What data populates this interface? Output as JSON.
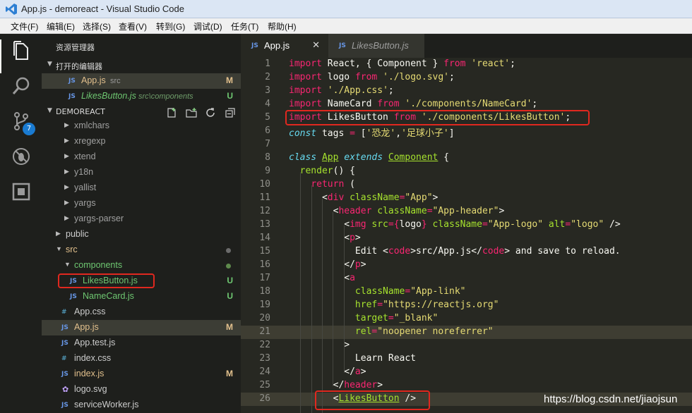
{
  "window": {
    "title": "App.js - demoreact - Visual Studio Code"
  },
  "menu": [
    "文件(F)",
    "编辑(E)",
    "选择(S)",
    "查看(V)",
    "转到(G)",
    "调试(D)",
    "任务(T)",
    "帮助(H)"
  ],
  "activity": {
    "scm_badge": "7"
  },
  "sidebar": {
    "title": "资源管理器",
    "open_editors_header": "打开的编辑器",
    "open_editors": [
      {
        "name": "App.js",
        "path": "src",
        "decoration": "M"
      },
      {
        "name": "LikesButton.js",
        "path": "src\\components",
        "decoration": "U"
      }
    ],
    "project_header": "DEMOREACT",
    "tree": [
      {
        "name": "xmlchars"
      },
      {
        "name": "xregexp"
      },
      {
        "name": "xtend"
      },
      {
        "name": "y18n"
      },
      {
        "name": "yallist"
      },
      {
        "name": "yargs"
      },
      {
        "name": "yargs-parser"
      },
      {
        "name": "public"
      },
      {
        "name": "src"
      },
      {
        "name": "components"
      },
      {
        "name": "LikesButton.js",
        "decoration": "U"
      },
      {
        "name": "NameCard.js",
        "decoration": "U"
      },
      {
        "name": "App.css"
      },
      {
        "name": "App.js",
        "decoration": "M"
      },
      {
        "name": "App.test.js"
      },
      {
        "name": "index.css"
      },
      {
        "name": "index.js",
        "decoration": "M"
      },
      {
        "name": "logo.svg"
      },
      {
        "name": "serviceWorker.js"
      }
    ]
  },
  "tabs": [
    {
      "name": "App.js",
      "icon_text": "JS",
      "close": "✕"
    },
    {
      "name": "LikesButton.js",
      "icon_text": "JS"
    }
  ],
  "file_icon_text": "JS",
  "code": {
    "line_numbers": [
      "1",
      "2",
      "3",
      "4",
      "5",
      "6",
      "7",
      "8",
      "9",
      "10",
      "11",
      "12",
      "13",
      "14",
      "15",
      "16",
      "17",
      "18",
      "19",
      "20",
      "21",
      "22",
      "23",
      "24",
      "25",
      "26"
    ],
    "lines": [
      [
        [
          "k",
          "import"
        ],
        [
          "p",
          " React, { Component } "
        ],
        [
          "k",
          "from"
        ],
        [
          "p",
          " "
        ],
        [
          "s",
          "'react'"
        ],
        [
          "p",
          ";"
        ]
      ],
      [
        [
          "k",
          "import"
        ],
        [
          "p",
          " logo "
        ],
        [
          "k",
          "from"
        ],
        [
          "p",
          " "
        ],
        [
          "s",
          "'./logo.svg'"
        ],
        [
          "p",
          ";"
        ]
      ],
      [
        [
          "k",
          "import"
        ],
        [
          "p",
          " "
        ],
        [
          "s",
          "'./App.css'"
        ],
        [
          "p",
          ";"
        ]
      ],
      [
        [
          "k",
          "import"
        ],
        [
          "p",
          " NameCard "
        ],
        [
          "k",
          "from"
        ],
        [
          "p",
          " "
        ],
        [
          "s",
          "'./components/NameCard'"
        ],
        [
          "p",
          ";"
        ]
      ],
      [
        [
          "k",
          "import"
        ],
        [
          "p",
          " LikesButton "
        ],
        [
          "k",
          "from"
        ],
        [
          "p",
          " "
        ],
        [
          "s",
          "'./components/LikesButton'"
        ],
        [
          "p",
          ";"
        ]
      ],
      [
        [
          "b",
          "const"
        ],
        [
          "p",
          " tags "
        ],
        [
          "k",
          "="
        ],
        [
          "p",
          " ["
        ],
        [
          "s",
          "'恐龙'"
        ],
        [
          "p",
          ","
        ],
        [
          "s",
          "'足球小子'"
        ],
        [
          "p",
          "]"
        ]
      ],
      [],
      [
        [
          "b",
          "class"
        ],
        [
          "p",
          " "
        ],
        [
          "c",
          "App"
        ],
        [
          "p",
          " "
        ],
        [
          "b",
          "extends"
        ],
        [
          "p",
          " "
        ],
        [
          "c",
          "Component"
        ],
        [
          "p",
          " {"
        ]
      ],
      [
        [
          "p",
          "  "
        ],
        [
          "a",
          "render"
        ],
        [
          "p",
          "() {"
        ]
      ],
      [
        [
          "p",
          "    "
        ],
        [
          "k",
          "return"
        ],
        [
          "p",
          " ("
        ]
      ],
      [
        [
          "p",
          "      <"
        ],
        [
          "k",
          "div"
        ],
        [
          "p",
          " "
        ],
        [
          "a",
          "className"
        ],
        [
          "k",
          "="
        ],
        [
          "s",
          "\"App\""
        ],
        [
          "p",
          ">"
        ]
      ],
      [
        [
          "p",
          "        <"
        ],
        [
          "k",
          "header"
        ],
        [
          "p",
          " "
        ],
        [
          "a",
          "className"
        ],
        [
          "k",
          "="
        ],
        [
          "s",
          "\"App-header\""
        ],
        [
          "p",
          ">"
        ]
      ],
      [
        [
          "p",
          "          <"
        ],
        [
          "k",
          "img"
        ],
        [
          "p",
          " "
        ],
        [
          "a",
          "src"
        ],
        [
          "k",
          "="
        ],
        [
          "k",
          "{"
        ],
        [
          "p",
          "logo"
        ],
        [
          "k",
          "}"
        ],
        [
          "p",
          " "
        ],
        [
          "a",
          "className"
        ],
        [
          "k",
          "="
        ],
        [
          "s",
          "\"App-logo\""
        ],
        [
          "p",
          " "
        ],
        [
          "a",
          "alt"
        ],
        [
          "k",
          "="
        ],
        [
          "s",
          "\"logo\""
        ],
        [
          "p",
          " />"
        ]
      ],
      [
        [
          "p",
          "          <"
        ],
        [
          "k",
          "p"
        ],
        [
          "p",
          ">"
        ]
      ],
      [
        [
          "p",
          "            Edit <"
        ],
        [
          "k",
          "code"
        ],
        [
          "p",
          ">src/App.js</"
        ],
        [
          "k",
          "code"
        ],
        [
          "p",
          "> and save to reload."
        ]
      ],
      [
        [
          "p",
          "          </"
        ],
        [
          "k",
          "p"
        ],
        [
          "p",
          ">"
        ]
      ],
      [
        [
          "p",
          "          <"
        ],
        [
          "k",
          "a"
        ]
      ],
      [
        [
          "p",
          "            "
        ],
        [
          "a",
          "className"
        ],
        [
          "k",
          "="
        ],
        [
          "s",
          "\"App-link\""
        ]
      ],
      [
        [
          "p",
          "            "
        ],
        [
          "a",
          "href"
        ],
        [
          "k",
          "="
        ],
        [
          "s",
          "\""
        ],
        [
          "s",
          "https://reactjs.org"
        ],
        [
          "s",
          "\""
        ]
      ],
      [
        [
          "p",
          "            "
        ],
        [
          "a",
          "target"
        ],
        [
          "k",
          "="
        ],
        [
          "s",
          "\"_blank\""
        ]
      ],
      [
        [
          "p",
          "            "
        ],
        [
          "a",
          "rel"
        ],
        [
          "k",
          "="
        ],
        [
          "s",
          "\"noopener noreferrer\""
        ]
      ],
      [
        [
          "p",
          "          >"
        ]
      ],
      [
        [
          "p",
          "            Learn React"
        ]
      ],
      [
        [
          "p",
          "          </"
        ],
        [
          "k",
          "a"
        ],
        [
          "p",
          ">"
        ]
      ],
      [
        [
          "p",
          "        </"
        ],
        [
          "k",
          "header"
        ],
        [
          "p",
          ">"
        ]
      ],
      [
        [
          "p",
          "        <"
        ],
        [
          "c",
          "LikesButton"
        ],
        [
          "p",
          " />"
        ]
      ]
    ]
  },
  "watermark": "https://blog.csdn.net/jiaojsun"
}
